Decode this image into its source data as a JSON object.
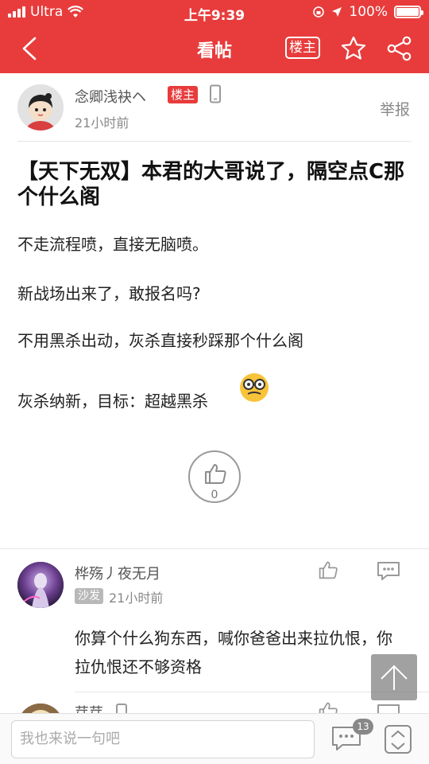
{
  "status": {
    "carrier": "Ultra",
    "time": "上午9:39",
    "battery": "100%",
    "battery_level": 1.0
  },
  "nav": {
    "title": "看帖",
    "louzhu_button": "楼主",
    "icons": [
      "back-arrow-icon",
      "star-icon",
      "share-icon"
    ]
  },
  "post": {
    "author": "念卿浅袂ヘ",
    "badge": "楼主",
    "time": "21小时前",
    "report": "举报",
    "title": "【天下无双】本君的大哥说了，隔空点C那个什么阁",
    "paragraphs": [
      "不走流程喷，直接无脑喷。",
      "新战场出来了，敢报名吗?",
      "不用黑杀出动，灰杀直接秒踩那个什么阁",
      "灰杀纳新，目标：超越黑杀"
    ],
    "like_count": "0"
  },
  "comments": [
    {
      "name": "桦殇丿夜无月",
      "badge": "沙发",
      "time": "21小时前",
      "text": "你算个什么狗东西，喊你爸爸出来拉仇恨，你拉仇恨还不够资格"
    },
    {
      "name": "芽芽"
    }
  ],
  "bottom": {
    "input_placeholder": "我也来说一句吧",
    "message_count": "13"
  },
  "colors": {
    "brand_red": "#e83c3c",
    "muted_text": "#888888"
  }
}
